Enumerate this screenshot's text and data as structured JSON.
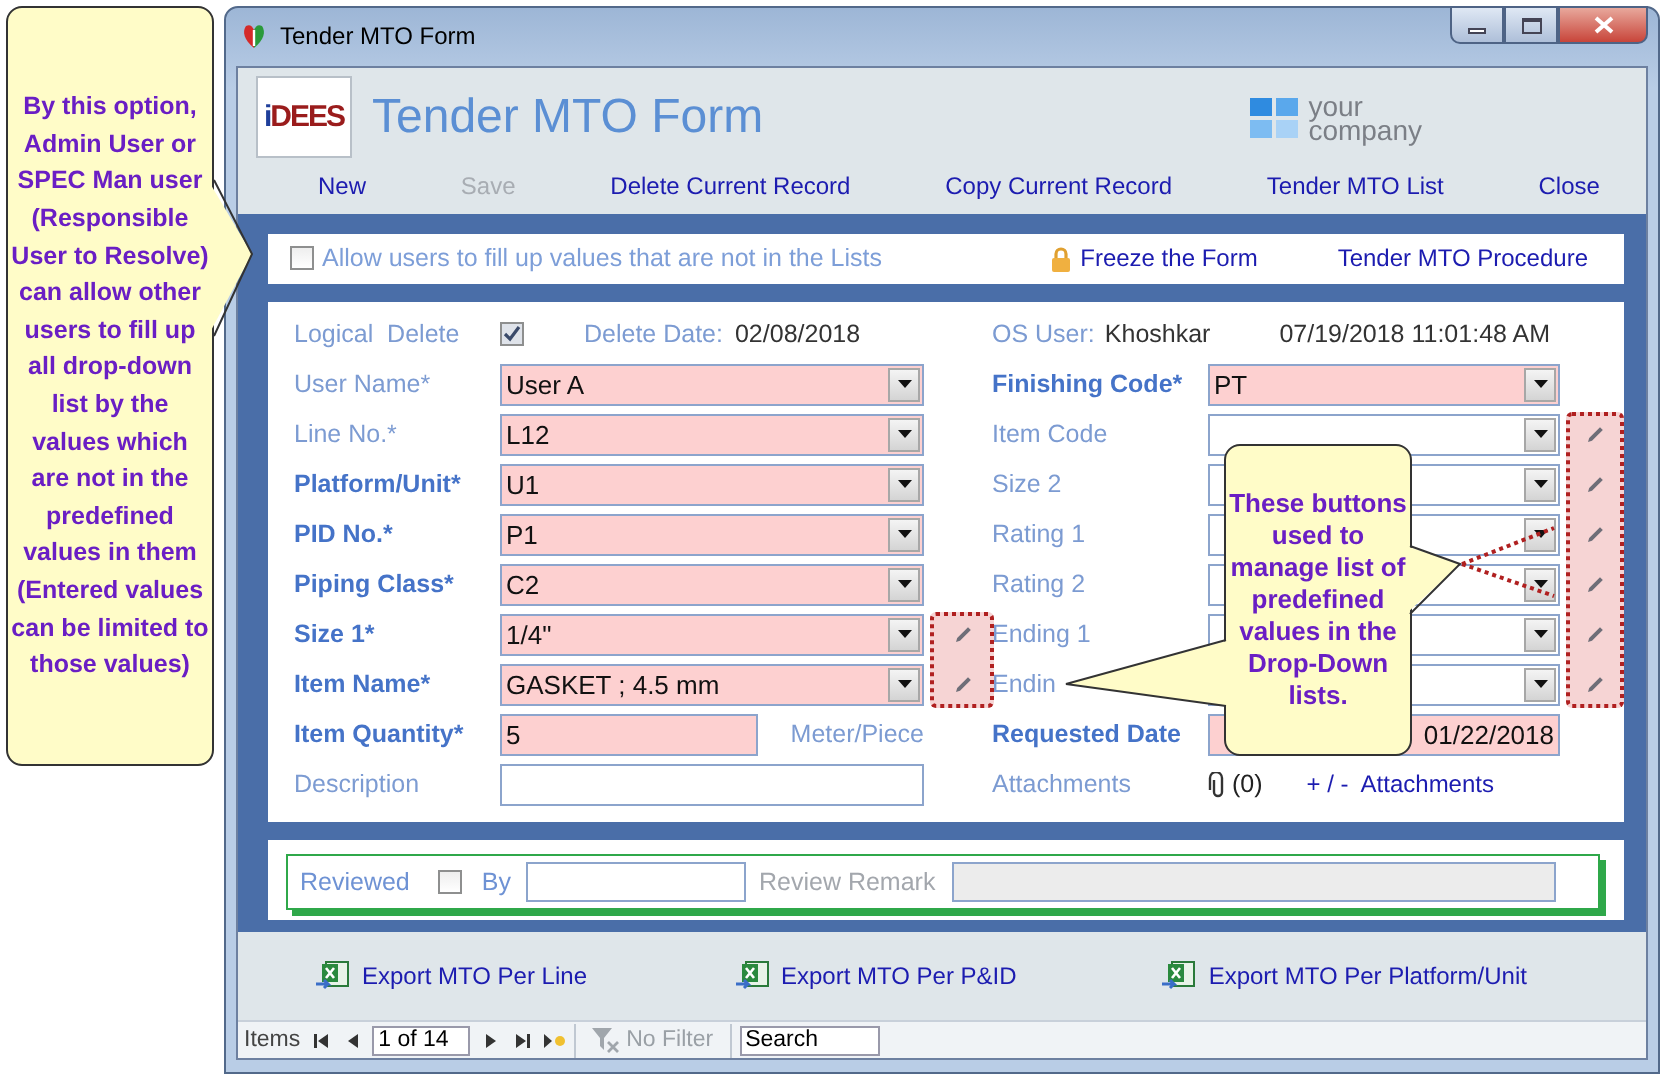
{
  "window": {
    "title": "Tender MTO Form"
  },
  "header": {
    "logo": "iDEES",
    "title": "Tender MTO Form",
    "company": [
      "your",
      "company"
    ]
  },
  "toolbar": [
    {
      "label": "New",
      "disabled": false
    },
    {
      "label": "Save",
      "disabled": true
    },
    {
      "label": "Delete Current Record",
      "disabled": false
    },
    {
      "label": "Copy Current Record",
      "disabled": false
    },
    {
      "label": "Tender MTO List",
      "disabled": false
    },
    {
      "label": "Close",
      "disabled": false
    }
  ],
  "options_bar": {
    "allow_free_values": {
      "label": "Allow users to fill up values that are not in the Lists",
      "checked": false
    },
    "links": [
      {
        "label": "Freeze the Form",
        "kind": "lock"
      },
      {
        "label": "Tender MTO Procedure",
        "kind": "plain"
      }
    ]
  },
  "form": {
    "logical_delete": {
      "label": "Logical  Delete",
      "checked": true
    },
    "delete_date": {
      "label": "Delete Date:",
      "value": "02/08/2018"
    },
    "os_user": {
      "label": "OS User:",
      "value": "Khoshkar"
    },
    "timestamp": "07/19/2018 11:01:48 AM",
    "left_fields": [
      {
        "label": "User Name*",
        "kind": "combo",
        "value": "User A",
        "required": true,
        "emphasized": false,
        "edit_button": false
      },
      {
        "label": "Line No.*",
        "kind": "combo",
        "value": "L12",
        "required": true,
        "emphasized": false,
        "edit_button": false
      },
      {
        "label": "Platform/Unit*",
        "kind": "combo",
        "value": "U1",
        "required": true,
        "emphasized": true,
        "edit_button": false
      },
      {
        "label": "PID No.*",
        "kind": "combo",
        "value": "P1",
        "required": true,
        "emphasized": true,
        "edit_button": false
      },
      {
        "label": "Piping Class*",
        "kind": "combo",
        "value": "C2",
        "required": true,
        "emphasized": true,
        "edit_button": false
      },
      {
        "label": "Size 1*",
        "kind": "combo",
        "value": "1/4\"",
        "required": true,
        "emphasized": true,
        "edit_button": true
      },
      {
        "label": "Item Name*",
        "kind": "combo",
        "value": "GASKET ; 4.5 mm",
        "required": true,
        "emphasized": true,
        "edit_button": true
      },
      {
        "label": "Item Quantity*",
        "kind": "text",
        "value": "5",
        "unit": "Meter/Piece",
        "required": true,
        "emphasized": true,
        "edit_button": false
      },
      {
        "label": "Description",
        "kind": "text",
        "required": false,
        "emphasized": false,
        "edit_button": false
      }
    ],
    "right_fields": [
      {
        "label": "Finishing Code*",
        "kind": "combo",
        "value": "PT",
        "required": true,
        "emphasized": true,
        "edit_button": false
      },
      {
        "label": "Item Code",
        "kind": "combo",
        "required": false,
        "emphasized": false,
        "edit_button": true
      },
      {
        "label": "Size 2",
        "kind": "combo",
        "required": false,
        "emphasized": false,
        "edit_button": true
      },
      {
        "label": "Rating 1",
        "kind": "combo",
        "required": false,
        "emphasized": false,
        "edit_button": true
      },
      {
        "label": "Rating 2",
        "kind": "combo",
        "required": false,
        "emphasized": false,
        "edit_button": true
      },
      {
        "label": "Ending 1",
        "kind": "combo",
        "required": false,
        "emphasized": false,
        "edit_button": true
      },
      {
        "label": "Endin",
        "kind": "combo",
        "required": false,
        "emphasized": false,
        "edit_button": true
      },
      {
        "label": "Requested Date",
        "kind": "date",
        "value": "01/22/2018",
        "required": true,
        "emphasized": true,
        "edit_button": false
      },
      {
        "label": "Attachments",
        "kind": "attachments",
        "count": "(0)",
        "link": "+ / -  Attachments"
      }
    ]
  },
  "review": {
    "reviewed": {
      "label": "Reviewed",
      "checked": false
    },
    "by": {
      "label": "By"
    },
    "remark": {
      "label": "Review Remark",
      "disabled": true
    }
  },
  "exports": [
    {
      "label": "Export MTO Per Line"
    },
    {
      "label": "Export MTO Per P&ID"
    },
    {
      "label": "Export MTO Per Platform/Unit"
    }
  ],
  "navigation": {
    "label": "Items",
    "record": "1 of 14",
    "filter": "No Filter",
    "search": "Search"
  },
  "callouts": [
    {
      "text": "By this option, Admin User or SPEC Man user (Responsible User to Resolve) can allow other users to fill up all drop-down list by the values which are not in the predefined values in them (Entered values can be limited to those values)"
    },
    {
      "text": "These buttons used to manage list of predefined values in the Drop-Down lists."
    }
  ]
}
